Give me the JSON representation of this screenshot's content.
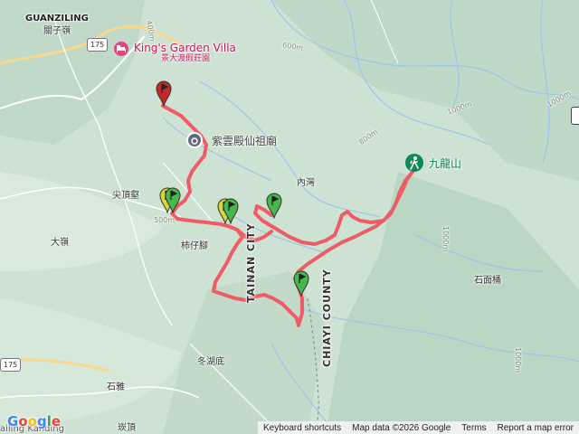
{
  "map": {
    "colors": {
      "background": "#cfe3d4",
      "route": "#ee5c65",
      "river": "#9ec3ee",
      "road": "#ffffff",
      "road_major": "#f7d98b",
      "peak_icon": "#0b8a57",
      "hotel_icon": "#e8437b",
      "temple_icon": "#5f6b7a",
      "county_border": "#8a8f96"
    },
    "town": {
      "name_en": "GUANZILING",
      "name_zh": "關子嶺"
    },
    "route_shields": [
      "175",
      "175"
    ],
    "pois": {
      "hotel": {
        "name": "King's Garden Villa",
        "name_zh": "景大渡假莊園",
        "icon": "hotel-icon"
      },
      "temple": {
        "name": "紫雲殿仙祖廟",
        "icon": "temple-icon"
      },
      "peak": {
        "name": "九龍山",
        "icon": "hiker-icon"
      }
    },
    "places": [
      "尖頂壑",
      "大嶺",
      "柿仔腳",
      "內灣",
      "石面桶",
      "冬湖底",
      "石雅",
      "崁頂"
    ],
    "county_labels": [
      "TAINAN CITY",
      "CHIAYI COUNTY"
    ],
    "contour_labels": [
      "400m",
      "600m",
      "800m",
      "1000m",
      "500m",
      "1000m",
      "1000m",
      "1000m"
    ],
    "markers": [
      {
        "name": "end",
        "color": "#c62828",
        "icon": "flag-pin-icon"
      },
      {
        "name": "waypoint-1",
        "color": "#d6d83a",
        "icon": "flag-pin-icon"
      },
      {
        "name": "waypoint-2",
        "color": "#44b84a",
        "icon": "flag-pin-icon"
      },
      {
        "name": "waypoint-3",
        "color": "#d6d83a",
        "icon": "flag-pin-icon"
      },
      {
        "name": "waypoint-4",
        "color": "#44b84a",
        "icon": "flag-pin-icon"
      },
      {
        "name": "waypoint-5",
        "color": "#44b84a",
        "icon": "flag-pin-icon"
      },
      {
        "name": "start",
        "color": "#44b84a",
        "icon": "flag-pin-icon"
      }
    ],
    "edge_text": {
      "bottom_left": "ailing Kanding"
    }
  },
  "google": {
    "logo": "Google",
    "attribution": [
      "Keyboard shortcuts",
      "Map data ©2026 Google",
      "Terms",
      "Report a map error"
    ]
  }
}
